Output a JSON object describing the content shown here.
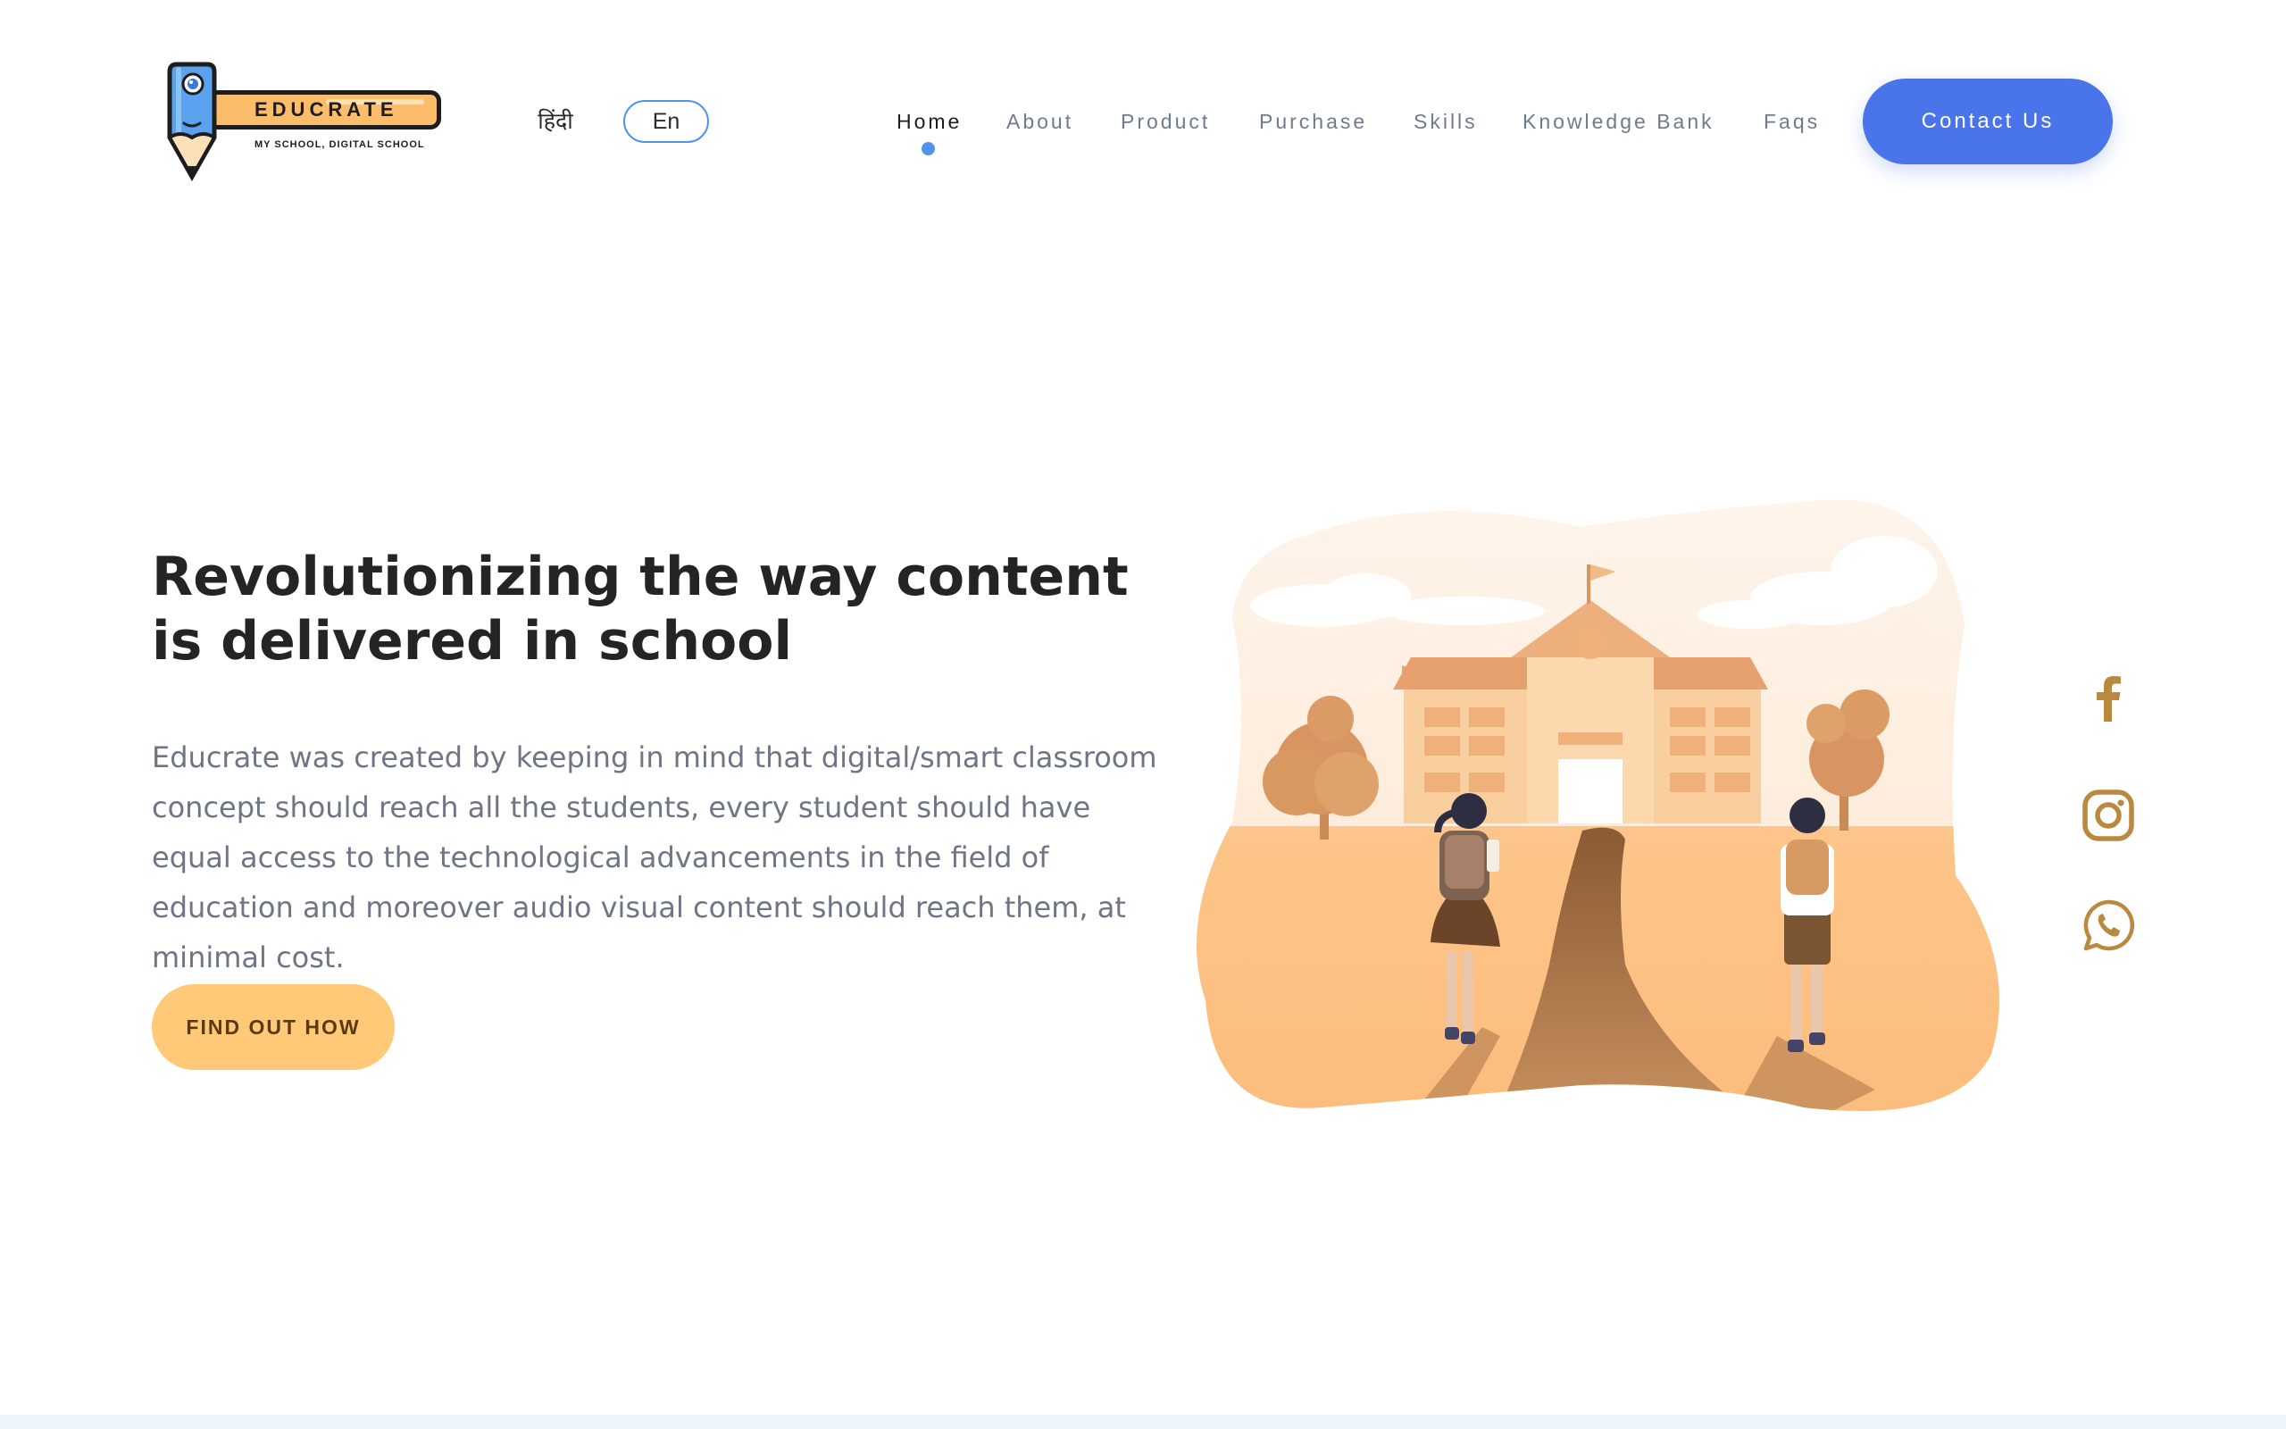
{
  "header": {
    "logo": {
      "name": "EDUCRATE",
      "tagline": "MY SCHOOL, DIGITAL SCHOOL",
      "icon": "pencil-mascot-icon"
    },
    "languages": [
      {
        "label": "हिंदी",
        "selected": false
      },
      {
        "label": "En",
        "selected": true
      }
    ],
    "nav": [
      {
        "label": "Home",
        "active": true
      },
      {
        "label": "About",
        "active": false
      },
      {
        "label": "Product",
        "active": false
      },
      {
        "label": "Purchase",
        "active": false
      },
      {
        "label": "Skills",
        "active": false
      },
      {
        "label": "Knowledge Bank",
        "active": false
      },
      {
        "label": "Faqs",
        "active": false
      }
    ],
    "contact_label": "Contact Us"
  },
  "hero": {
    "title": "Revolutionizing the way content is delivered in school",
    "body": "Educrate was created by keeping in mind that digital/smart classroom concept should reach all the students, every student should have equal access to the technological advancements in the field of education and moreover audio visual content should reach them, at minimal cost.",
    "cta_label": "FIND OUT HOW",
    "illustration": "students-walking-to-school-illustration"
  },
  "social": [
    {
      "name": "facebook-icon"
    },
    {
      "name": "instagram-icon"
    },
    {
      "name": "whatsapp-icon"
    }
  ],
  "colors": {
    "accent_blue": "#4a74ea",
    "nav_dot": "#4f93ec",
    "cta_yellow": "#ffc977",
    "social_gold": "#b8893e",
    "title": "#242424",
    "body_text": "#6e7585"
  }
}
